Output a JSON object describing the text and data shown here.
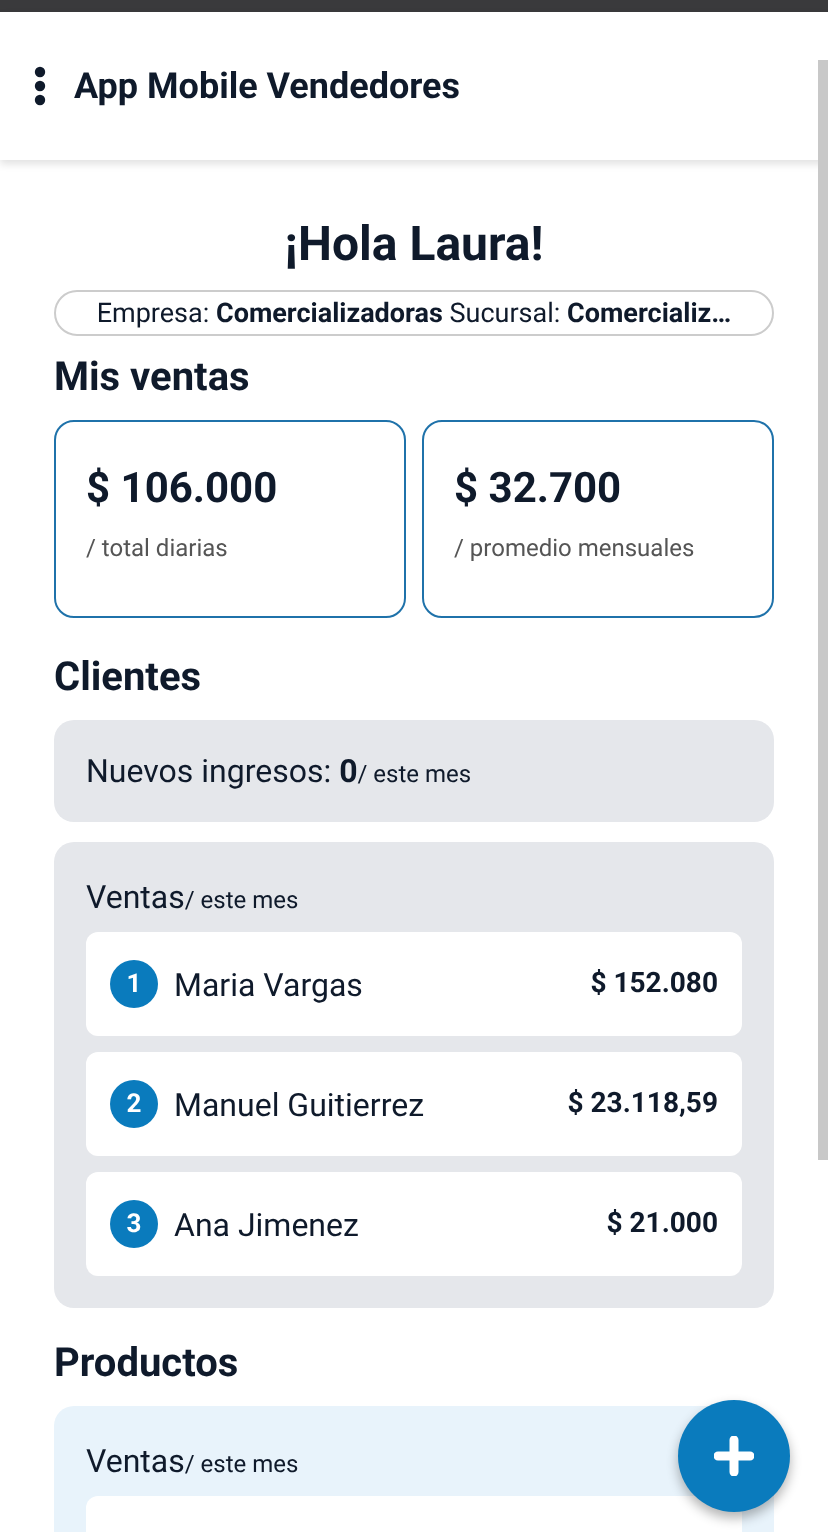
{
  "app_bar": {
    "title": "App Mobile Vendedores"
  },
  "greeting": "¡Hola Laura!",
  "context": "Empresa: **Comercializadoras** Sucursal: **Comercializ…**",
  "sales": {
    "title": "Mis ventas",
    "cards": [
      {
        "amount": "$ 106.000",
        "caption": "/ total diarias"
      },
      {
        "amount": "$ 32.700",
        "caption": "/ promedio mensuales"
      }
    ]
  },
  "clients": {
    "title": "Clientes",
    "new_label": "Nuevos ingresos: **0**",
    "new_suffix": "/ este mes",
    "ranking": {
      "label": "Ventas",
      "suffix": "/ este mes",
      "items": [
        {
          "rank": "1",
          "name": "Maria Vargas",
          "amount": "$ 152.080"
        },
        {
          "rank": "2",
          "name": "Manuel Guitierrez",
          "amount": "$ 23.118,59"
        },
        {
          "rank": "3",
          "name": "Ana Jimenez",
          "amount": "$ 21.000"
        }
      ]
    }
  },
  "products": {
    "title": "Productos",
    "ranking": {
      "label": "Ventas",
      "suffix": "/ este mes"
    }
  }
}
